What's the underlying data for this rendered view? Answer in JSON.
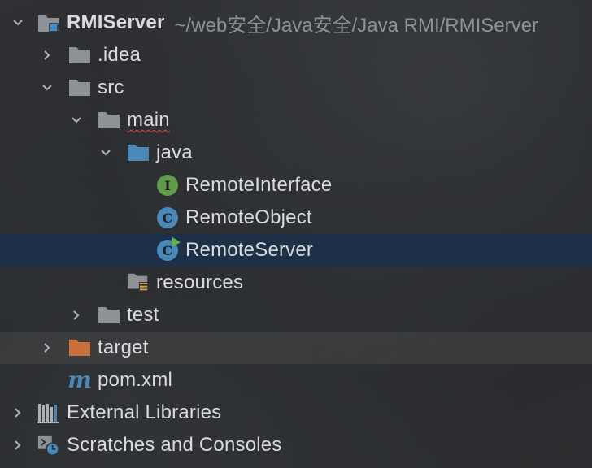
{
  "colors": {
    "folder": "#8e9296",
    "source_folder": "#4a88b8",
    "excluded_folder": "#c9703d",
    "interface_icon": "#5f9b49",
    "class_icon": "#4a88b8",
    "selection": "#1d3047",
    "run_marker": "#62b543"
  },
  "tree": {
    "root": {
      "label": "RMIServer",
      "path": "~/web安全/Java安全/Java RMI/RMIServer",
      "icon": "module-folder-icon"
    },
    "idea": {
      "label": ".idea",
      "icon": "folder-icon"
    },
    "src": {
      "label": "src",
      "icon": "folder-icon"
    },
    "main": {
      "label": "main",
      "icon": "folder-icon"
    },
    "java": {
      "label": "java",
      "icon": "source-folder-icon"
    },
    "remote_interface": {
      "label": "RemoteInterface",
      "icon": "interface-icon",
      "glyph": "I"
    },
    "remote_object": {
      "label": "RemoteObject",
      "icon": "class-icon",
      "glyph": "C"
    },
    "remote_server": {
      "label": "RemoteServer",
      "icon": "runnable-class-icon",
      "glyph": "C"
    },
    "resources": {
      "label": "resources",
      "icon": "resources-folder-icon"
    },
    "test": {
      "label": "test",
      "icon": "folder-icon"
    },
    "target": {
      "label": "target",
      "icon": "excluded-folder-icon"
    },
    "pom": {
      "label": "pom.xml",
      "icon": "maven-icon",
      "glyph": "m"
    },
    "external_libraries": {
      "label": "External Libraries",
      "icon": "libraries-icon"
    },
    "scratches": {
      "label": "Scratches and Consoles",
      "icon": "scratches-icon"
    }
  }
}
